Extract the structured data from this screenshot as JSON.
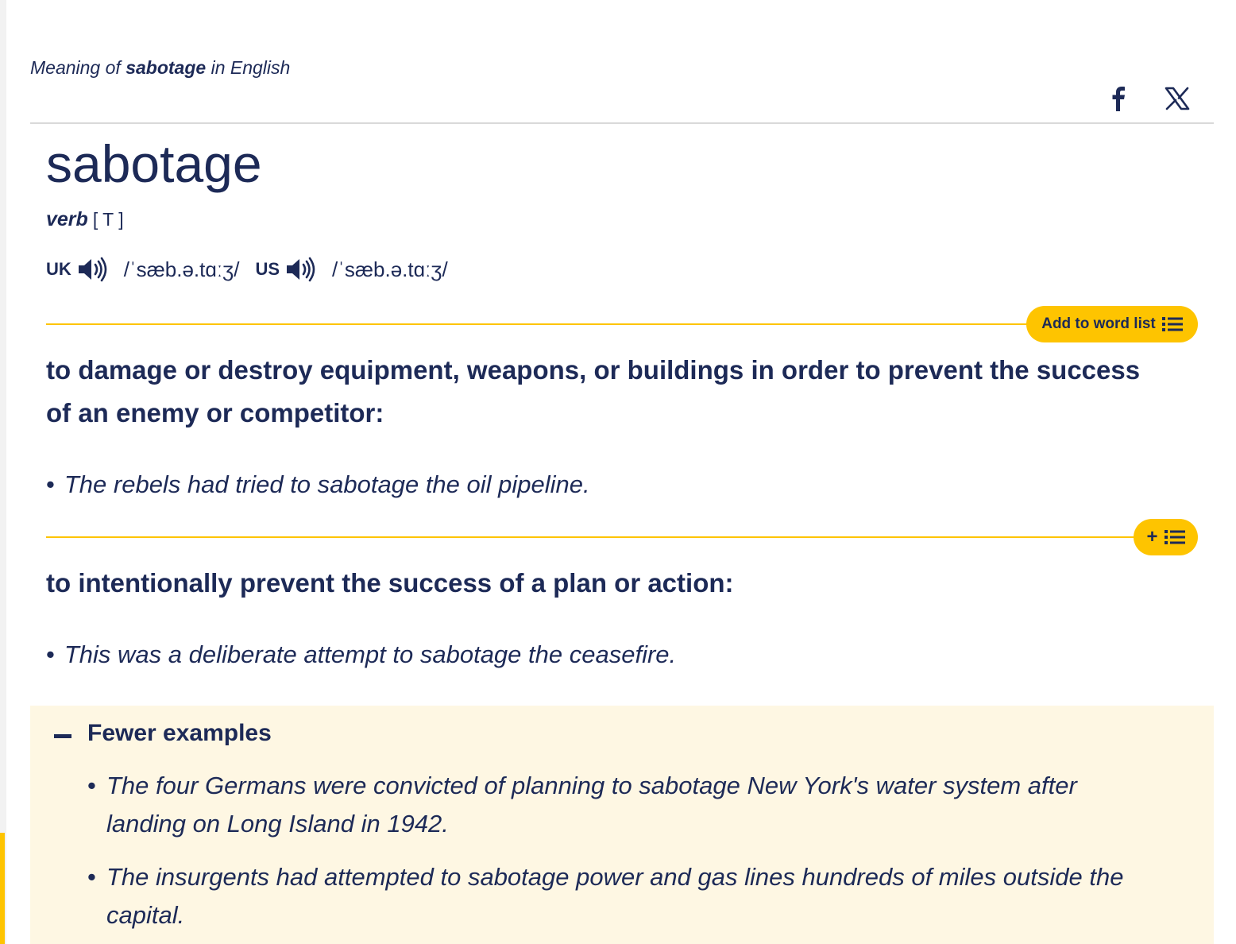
{
  "page": {
    "meaning_prefix": "Meaning of ",
    "meaning_word": "sabotage",
    "meaning_suffix": " in English"
  },
  "share": {
    "icons": [
      "facebook-icon",
      "x-icon"
    ]
  },
  "entry": {
    "headword": "sabotage",
    "pos": "verb",
    "grammar": "[ T ]",
    "pronunciations": [
      {
        "region": "UK",
        "ipa": "/ˈsæb.ə.tɑːʒ/"
      },
      {
        "region": "US",
        "ipa": "/ˈsæb.ə.tɑːʒ/"
      }
    ]
  },
  "word_list": {
    "add_label": "Add to word list",
    "small_label": "+"
  },
  "senses": [
    {
      "definition": "to damage or destroy equipment, weapons, or buildings in order to prevent the success of an enemy or competitor:",
      "examples": [
        "The rebels had tried to sabotage the oil pipeline."
      ]
    },
    {
      "definition": "to intentionally prevent the success of a plan or action:",
      "examples": [
        "This was a deliberate attempt to sabotage the ceasefire."
      ]
    }
  ],
  "more_examples": {
    "toggle_label": "Fewer examples",
    "items": [
      "The four Germans were convicted of planning to sabotage New York's water system after landing on Long Island in 1942.",
      "The insurgents had attempted to sabotage power and gas lines hundreds of miles outside the capital."
    ]
  },
  "colors": {
    "text": "#1d2a57",
    "accent": "#fec400",
    "examples_bg": "#fef7e3",
    "rule": "#d9d9d9"
  }
}
